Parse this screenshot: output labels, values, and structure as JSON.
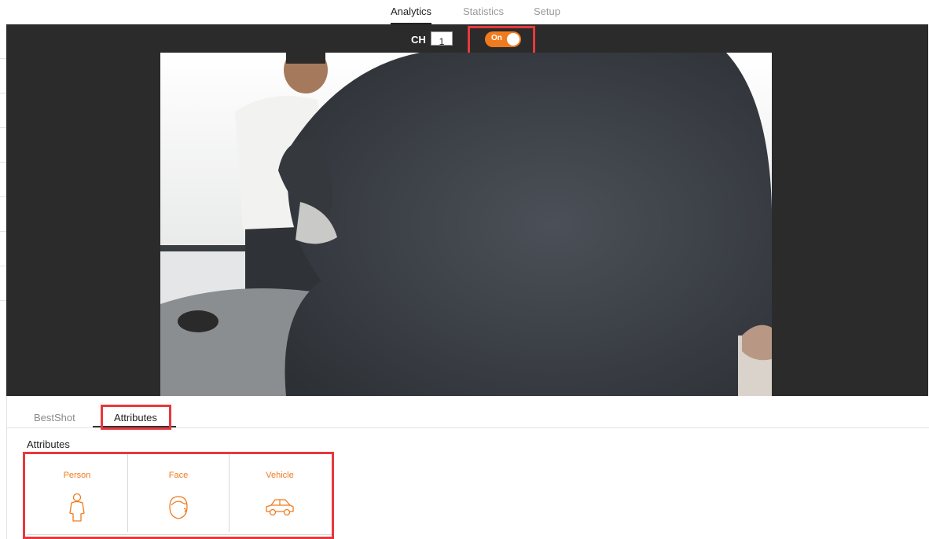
{
  "top_nav": {
    "tabs": [
      {
        "label": "Analytics",
        "active": true
      },
      {
        "label": "Statistics",
        "active": false
      },
      {
        "label": "Setup",
        "active": false
      }
    ]
  },
  "video": {
    "ch_label": "CH",
    "ch_value": "1",
    "toggle_label": "On",
    "toggle_state": "on",
    "accent_color": "#f07b1e"
  },
  "sub_tabs": [
    {
      "label": "BestShot",
      "active": false
    },
    {
      "label": "Attributes",
      "active": true
    }
  ],
  "attributes": {
    "title": "Attributes",
    "items": [
      {
        "label": "Person",
        "icon": "person-icon"
      },
      {
        "label": "Face",
        "icon": "face-icon"
      },
      {
        "label": "Vehicle",
        "icon": "car-icon"
      }
    ]
  },
  "highlight_color": "#e8383d"
}
